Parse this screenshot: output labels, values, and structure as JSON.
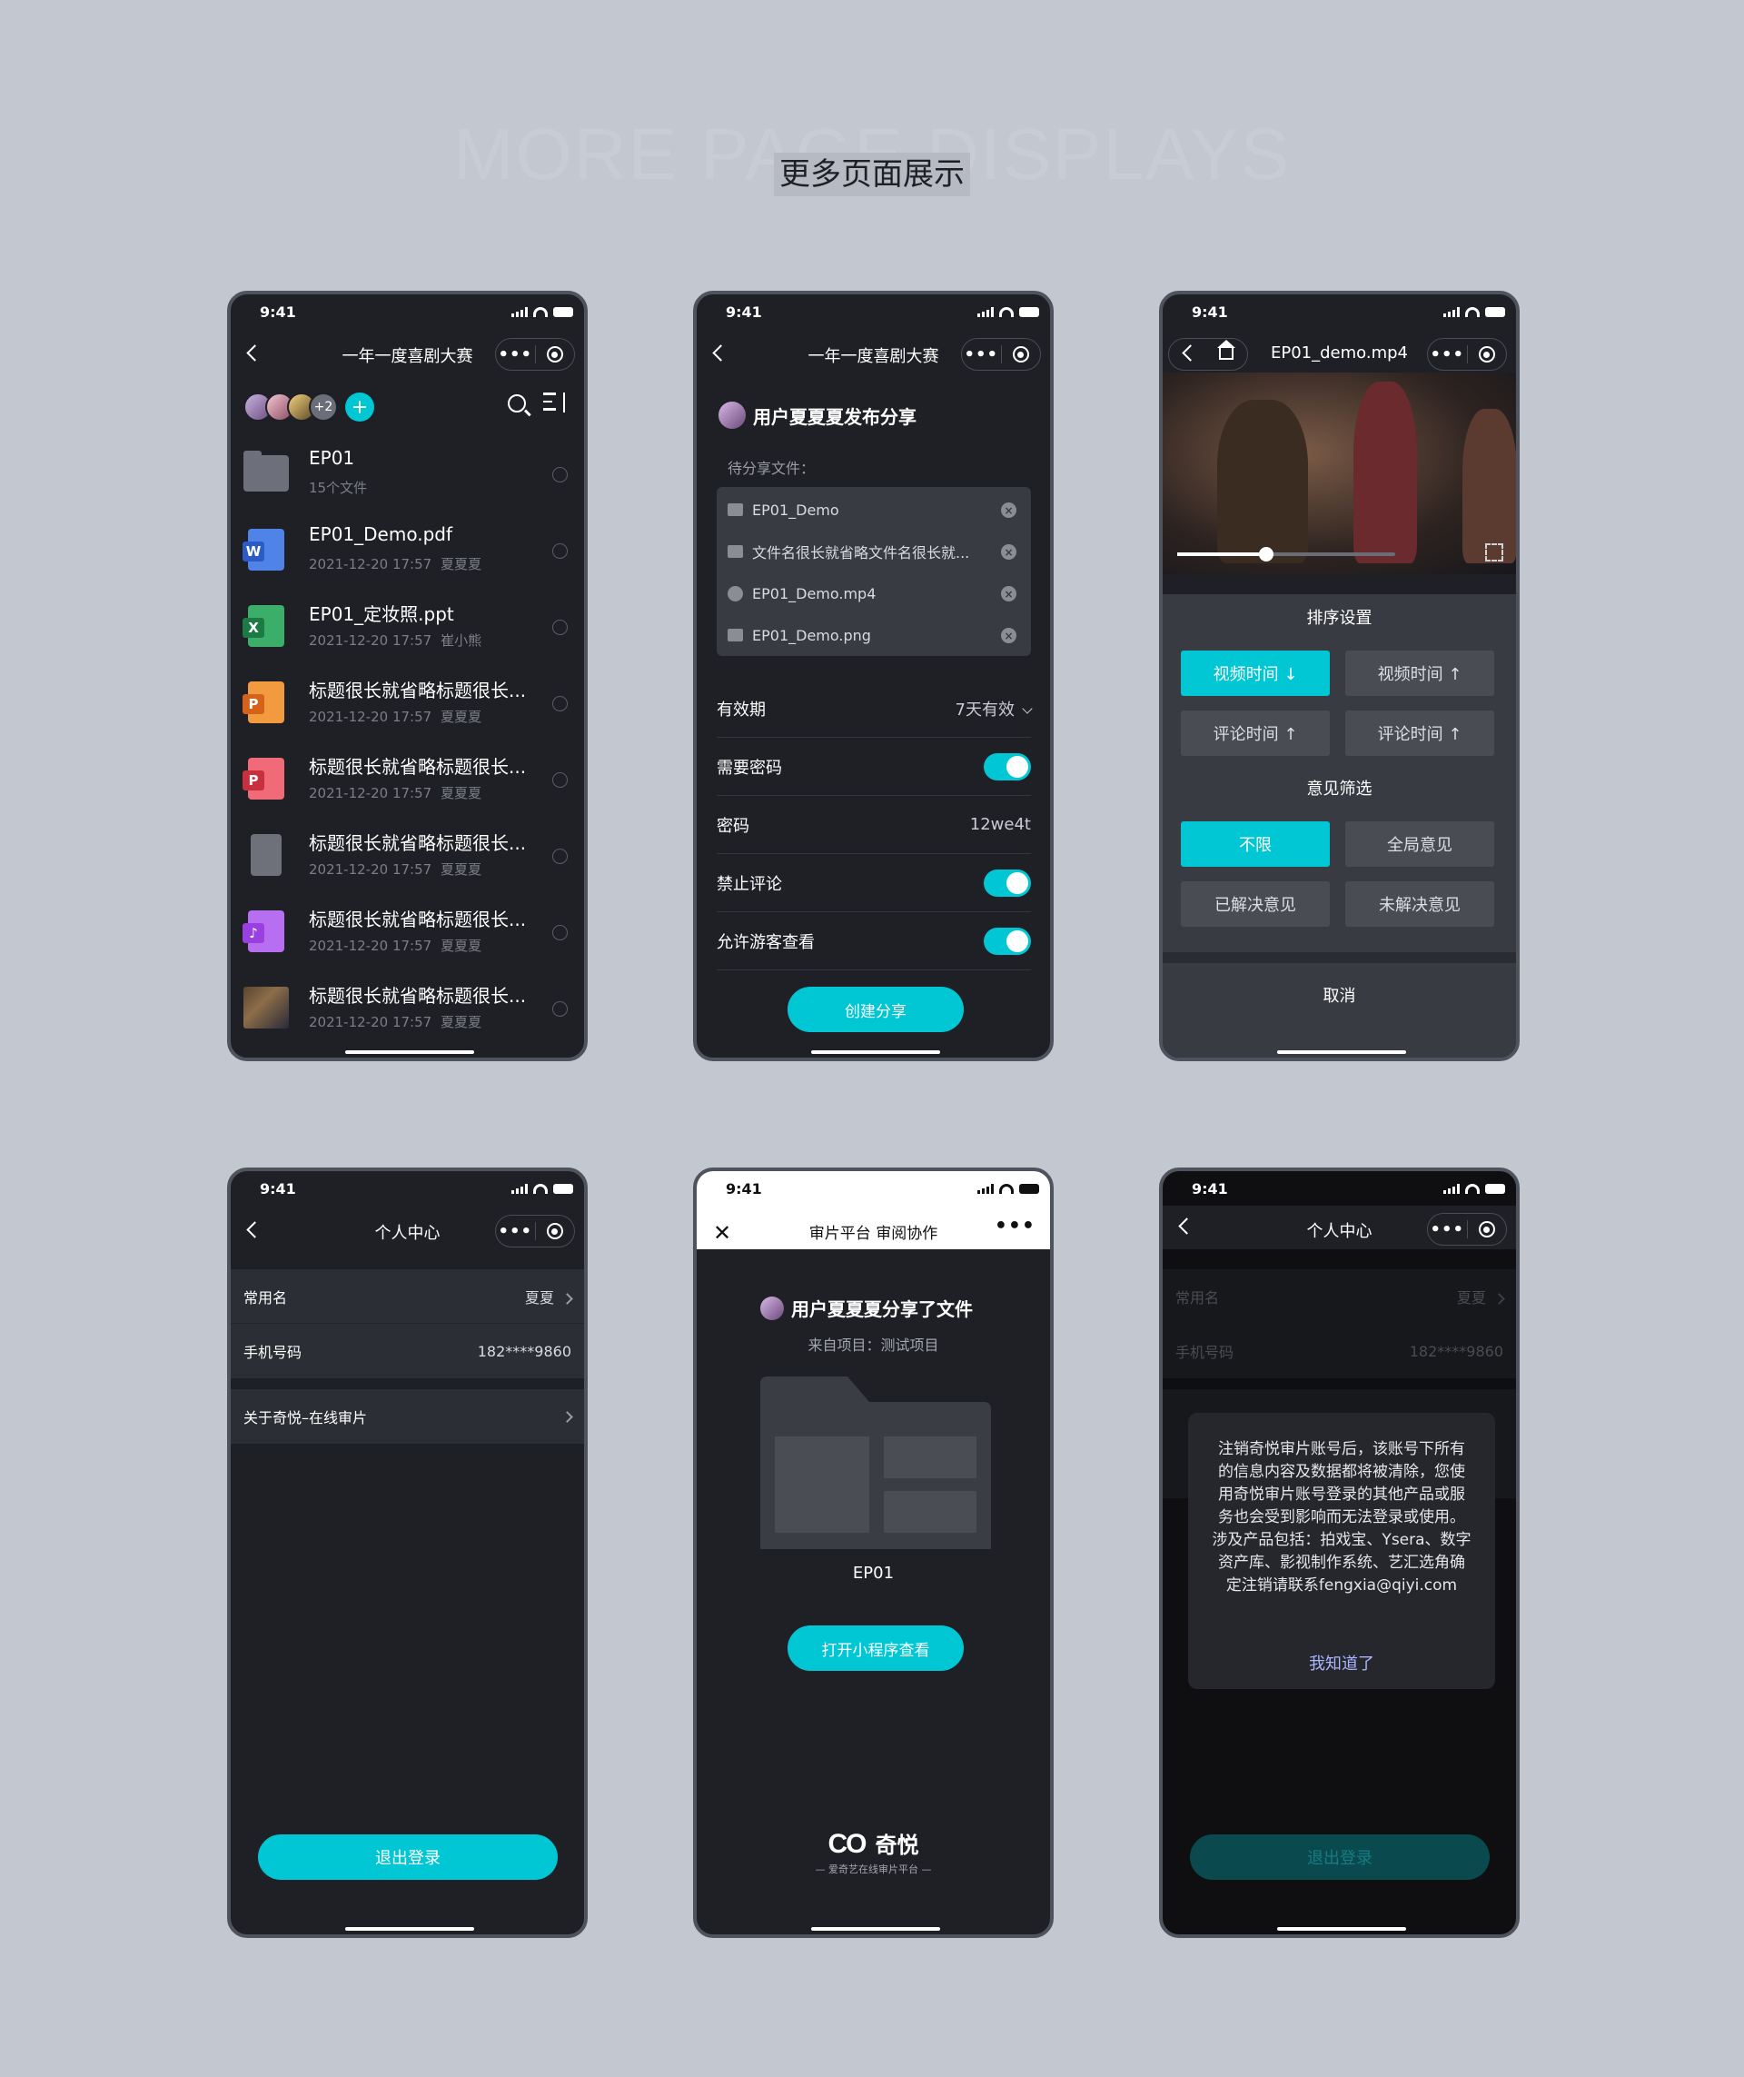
{
  "bg_word": "MORE PAGE DISPLAYS",
  "heading": "更多页面展示",
  "status_time": "9:41",
  "colors": {
    "accent": "#00c7d3",
    "bg": "#c3c7d0",
    "phone_bg": "#1f2026"
  },
  "screen1": {
    "title": "一年一度喜剧大赛",
    "more_avatars": "+2",
    "files": [
      {
        "name": "EP01",
        "date": "15个文件",
        "owner": "",
        "icon": "folder-icon"
      },
      {
        "name": "EP01_Demo.pdf",
        "date": "2021-12-20 17:57",
        "owner": "夏夏夏",
        "icon": "word-file-icon"
      },
      {
        "name": "EP01_定妆照.ppt",
        "date": "2021-12-20 17:57",
        "owner": "崔小熊",
        "icon": "excel-file-icon"
      },
      {
        "name": "标题很长就省略标题很长...",
        "date": "2021-12-20 17:57",
        "owner": "夏夏夏",
        "icon": "ppt-file-icon"
      },
      {
        "name": "标题很长就省略标题很长...",
        "date": "2021-12-20 17:57",
        "owner": "夏夏夏",
        "icon": "pdf-file-icon"
      },
      {
        "name": "标题很长就省略标题很长...",
        "date": "2021-12-20 17:57",
        "owner": "夏夏夏",
        "icon": "generic-file-icon"
      },
      {
        "name": "标题很长就省略标题很长...",
        "date": "2021-12-20 17:57",
        "owner": "夏夏夏",
        "icon": "audio-file-icon"
      },
      {
        "name": "标题很长就省略标题很长...",
        "date": "2021-12-20 17:57",
        "owner": "夏夏夏",
        "icon": "image-thumbnail"
      }
    ]
  },
  "screen2": {
    "title": "一年一度喜剧大赛",
    "publisher": "用户夏夏夏发布分享",
    "pending_label": "待分享文件：",
    "pending_files": [
      "EP01_Demo",
      "文件名很长就省略文件名很长就...",
      "EP01_Demo.mp4",
      "EP01_Demo.png"
    ],
    "validity_label": "有效期",
    "validity_value": "7天有效",
    "need_password_label": "需要密码",
    "password_label": "密码",
    "password_value": "12we4t",
    "no_comment_label": "禁止评论",
    "guest_view_label": "允许游客查看",
    "create_button": "创建分享"
  },
  "screen3": {
    "title": "EP01_demo.mp4",
    "sort_title": "排序设置",
    "sort_options": [
      "视频时间 ↓",
      "视频时间 ↑",
      "评论时间 ↑",
      "评论时间 ↑"
    ],
    "filter_title": "意见筛选",
    "filter_options": [
      "不限",
      "全局意见",
      "已解决意见",
      "未解决意见"
    ],
    "cancel": "取消"
  },
  "screen4": {
    "title": "个人中心",
    "name_label": "常用名",
    "name_value": "夏夏",
    "phone_label": "手机号码",
    "phone_value": "182****9860",
    "about_label": "关于奇悦–在线审片",
    "logout": "退出登录"
  },
  "screen5": {
    "title": "审片平台 审阅协作",
    "share_title": "用户夏夏夏分享了文件",
    "project": "来自项目：测试项目",
    "folder_name": "EP01",
    "open_button": "打开小程序查看",
    "logo_text": "奇悦",
    "logo_sub": "爱奇艺在线审片平台"
  },
  "screen6": {
    "title": "个人中心",
    "name_label": "常用名",
    "name_value": "夏夏",
    "phone_label": "手机号码",
    "phone_value": "182****9860",
    "dialog_text": "注销奇悦审片账号后，该账号下所有的信息内容及数据都将被清除，您使用奇悦审片账号登录的其他产品或服务也会受到影响而无法登录或使用。涉及产品包括：拍戏宝、Ysera、数字资产库、影视制作系统、艺汇选角确定注销请联系fengxia@qiyi.com",
    "dialog_ok": "我知道了",
    "logout": "退出登录"
  }
}
